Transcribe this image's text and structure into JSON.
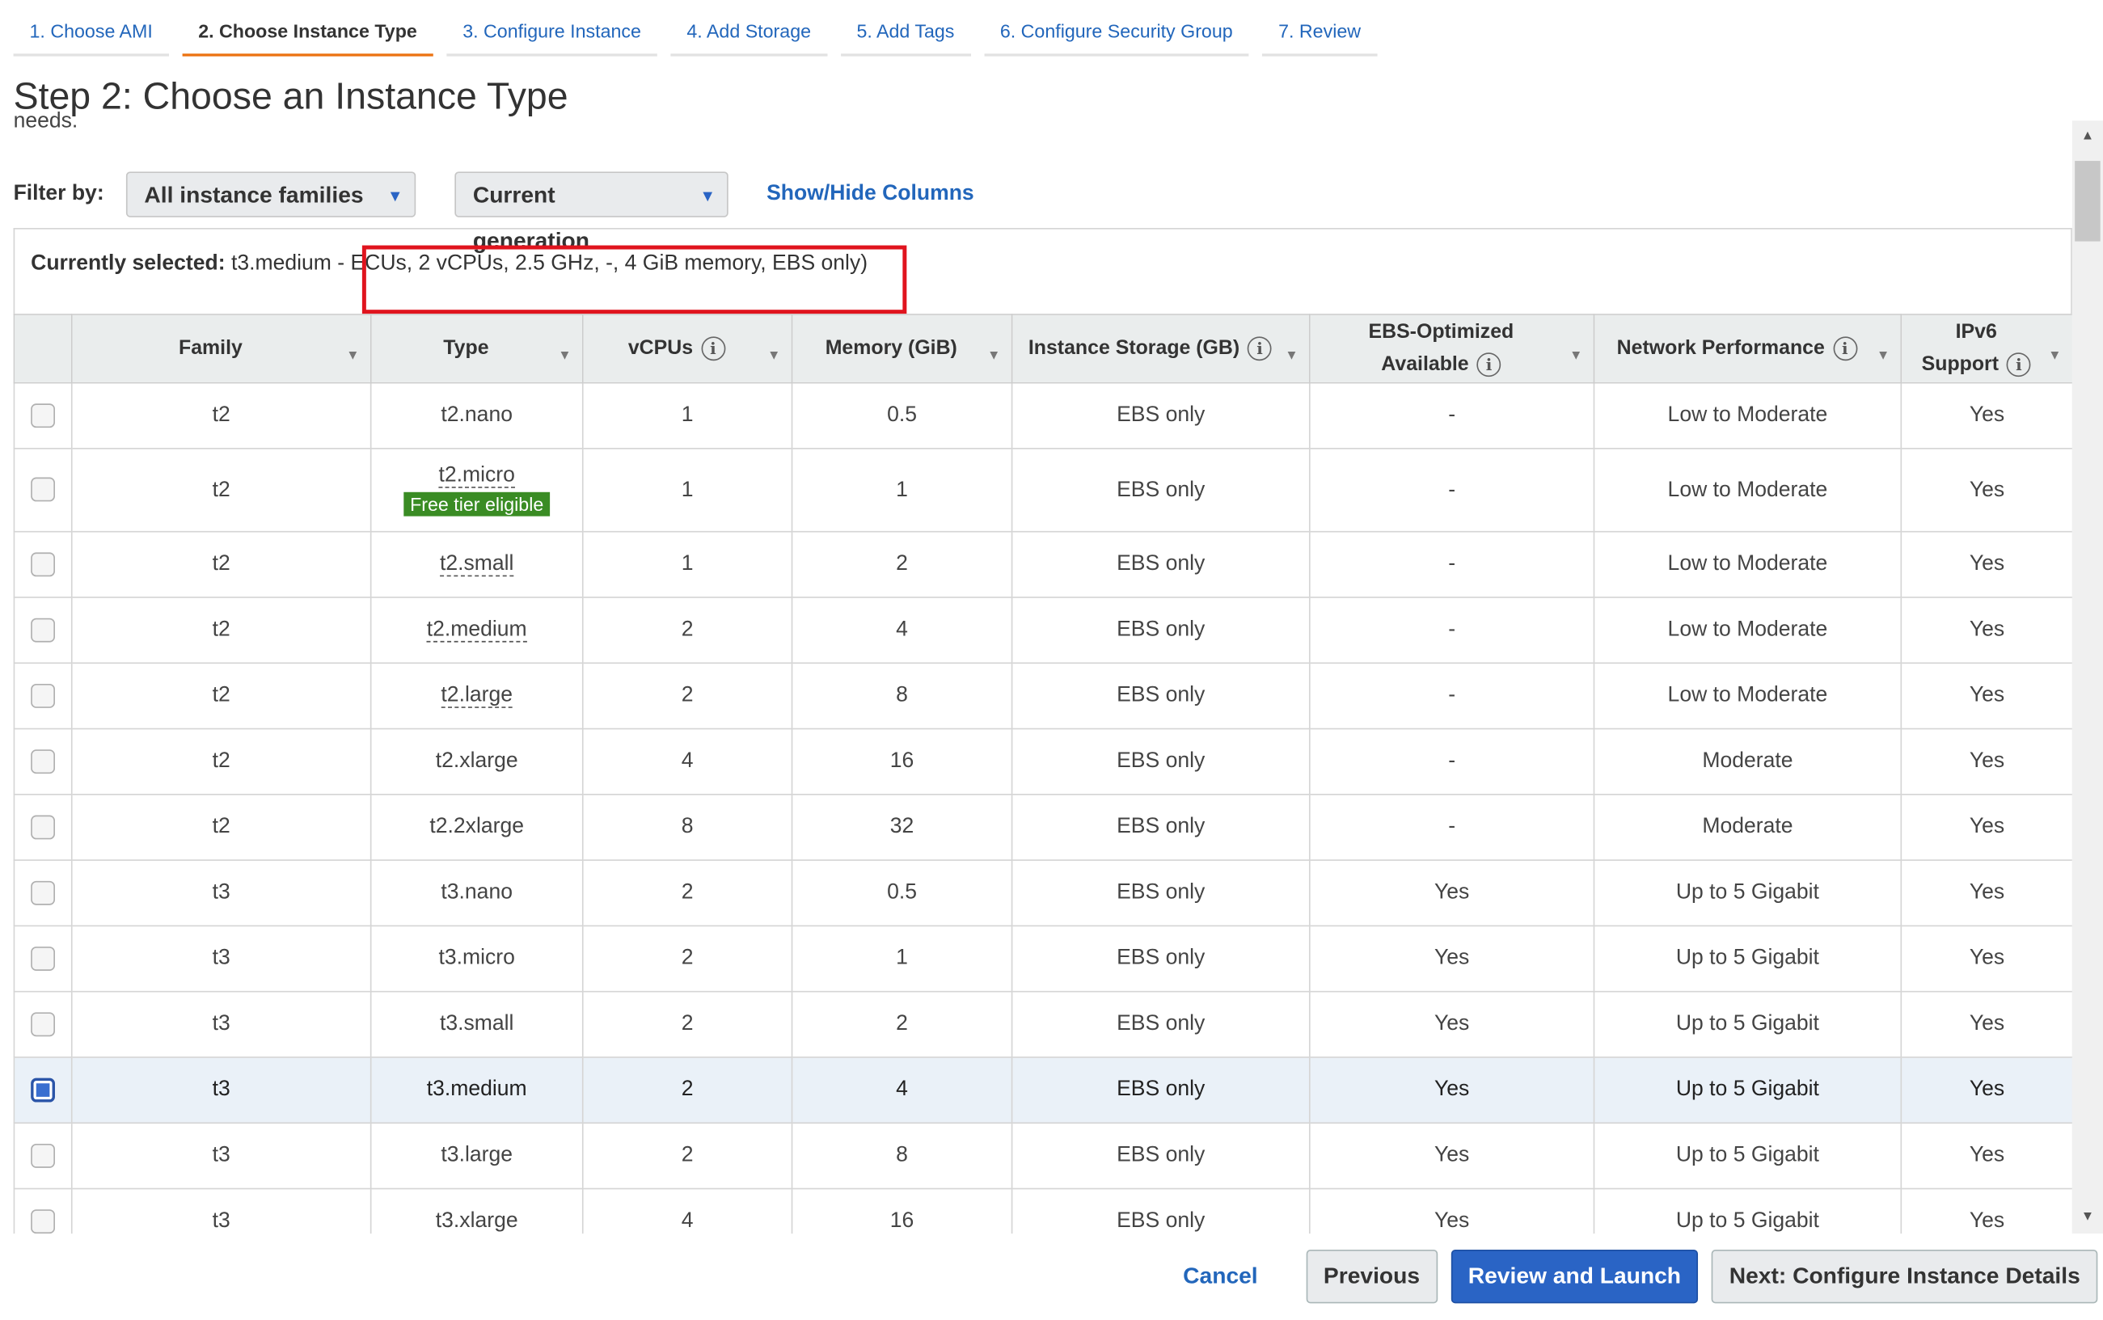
{
  "tabs": [
    {
      "label": "1. Choose AMI"
    },
    {
      "label": "2. Choose Instance Type"
    },
    {
      "label": "3. Configure Instance"
    },
    {
      "label": "4. Add Storage"
    },
    {
      "label": "5. Add Tags"
    },
    {
      "label": "6. Configure Security Group"
    },
    {
      "label": "7. Review"
    }
  ],
  "page": {
    "title": "Step 2: Choose an Instance Type",
    "clipped_text": "needs."
  },
  "filter": {
    "label": "Filter by:",
    "family_select": "All instance families",
    "generation_select": "Current generation",
    "columns_link": "Show/Hide Columns"
  },
  "selection": {
    "label": "Currently selected:",
    "instance": "t3.medium",
    "details": "- ECUs, 2 vCPUs, 2.5 GHz, -, 4 GiB memory, EBS only)"
  },
  "table": {
    "headers": {
      "family": "Family",
      "type": "Type",
      "vcpus": "vCPUs",
      "memory": "Memory (GiB)",
      "storage": "Instance Storage (GB)",
      "ebs_line1": "EBS-Optimized",
      "ebs_line2": "Available",
      "network": "Network Performance",
      "ipv6_line1": "IPv6",
      "ipv6_line2": "Support"
    },
    "free_tier_badge": "Free tier eligible",
    "rows": [
      {
        "family": "t2",
        "type": "t2.nano",
        "vcpus": "1",
        "memory": "0.5",
        "storage": "EBS only",
        "ebs": "-",
        "network": "Low to Moderate",
        "ipv6": "Yes"
      },
      {
        "family": "t2",
        "type": "t2.micro",
        "vcpus": "1",
        "memory": "1",
        "storage": "EBS only",
        "ebs": "-",
        "network": "Low to Moderate",
        "ipv6": "Yes"
      },
      {
        "family": "t2",
        "type": "t2.small",
        "vcpus": "1",
        "memory": "2",
        "storage": "EBS only",
        "ebs": "-",
        "network": "Low to Moderate",
        "ipv6": "Yes"
      },
      {
        "family": "t2",
        "type": "t2.medium",
        "vcpus": "2",
        "memory": "4",
        "storage": "EBS only",
        "ebs": "-",
        "network": "Low to Moderate",
        "ipv6": "Yes"
      },
      {
        "family": "t2",
        "type": "t2.large",
        "vcpus": "2",
        "memory": "8",
        "storage": "EBS only",
        "ebs": "-",
        "network": "Low to Moderate",
        "ipv6": "Yes"
      },
      {
        "family": "t2",
        "type": "t2.xlarge",
        "vcpus": "4",
        "memory": "16",
        "storage": "EBS only",
        "ebs": "-",
        "network": "Moderate",
        "ipv6": "Yes"
      },
      {
        "family": "t2",
        "type": "t2.2xlarge",
        "vcpus": "8",
        "memory": "32",
        "storage": "EBS only",
        "ebs": "-",
        "network": "Moderate",
        "ipv6": "Yes"
      },
      {
        "family": "t3",
        "type": "t3.nano",
        "vcpus": "2",
        "memory": "0.5",
        "storage": "EBS only",
        "ebs": "Yes",
        "network": "Up to 5 Gigabit",
        "ipv6": "Yes"
      },
      {
        "family": "t3",
        "type": "t3.micro",
        "vcpus": "2",
        "memory": "1",
        "storage": "EBS only",
        "ebs": "Yes",
        "network": "Up to 5 Gigabit",
        "ipv6": "Yes"
      },
      {
        "family": "t3",
        "type": "t3.small",
        "vcpus": "2",
        "memory": "2",
        "storage": "EBS only",
        "ebs": "Yes",
        "network": "Up to 5 Gigabit",
        "ipv6": "Yes"
      },
      {
        "family": "t3",
        "type": "t3.medium",
        "vcpus": "2",
        "memory": "4",
        "storage": "EBS only",
        "ebs": "Yes",
        "network": "Up to 5 Gigabit",
        "ipv6": "Yes"
      },
      {
        "family": "t3",
        "type": "t3.large",
        "vcpus": "2",
        "memory": "8",
        "storage": "EBS only",
        "ebs": "Yes",
        "network": "Up to 5 Gigabit",
        "ipv6": "Yes"
      },
      {
        "family": "t3",
        "type": "t3.xlarge",
        "vcpus": "4",
        "memory": "16",
        "storage": "EBS only",
        "ebs": "Yes",
        "network": "Up to 5 Gigabit",
        "ipv6": "Yes"
      }
    ]
  },
  "footer": {
    "cancel": "Cancel",
    "previous": "Previous",
    "review": "Review and Launch",
    "next": "Next: Configure Instance Details"
  },
  "colors": {
    "accent": "#2a64c5",
    "active_tab": "#ec7211",
    "highlight_box": "#e0141e",
    "free_tier": "#3a8c24",
    "selected_row": "#eaf1f8"
  }
}
